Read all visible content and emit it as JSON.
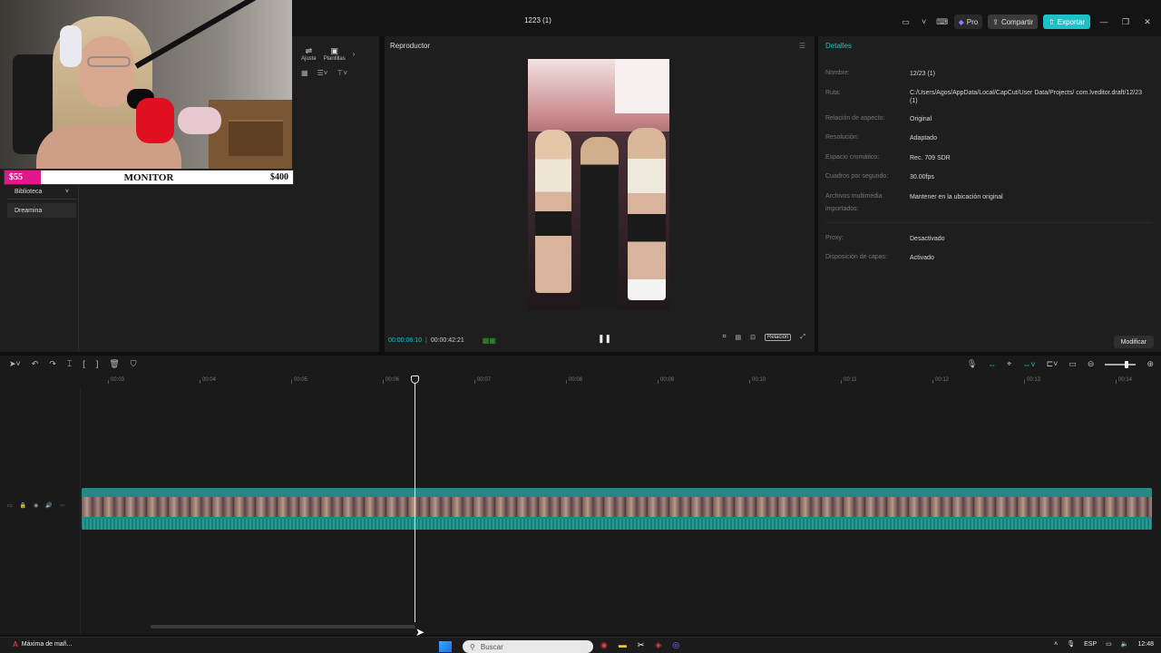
{
  "window": {
    "title": "1223 (1)"
  },
  "titlebar": {
    "pro_label": "Pro",
    "share_label": "Compartir",
    "export_label": "Exportar"
  },
  "overlay": {
    "cost": "$55",
    "label": "MONITOR",
    "goal": "$400"
  },
  "media": {
    "tools": [
      {
        "label": "Ajuste",
        "icon": "sliders-icon"
      },
      {
        "label": "Plantillas",
        "icon": "template-icon"
      }
    ],
    "side_items": [
      {
        "label": "Biblioteca"
      },
      {
        "label": "Dreamina"
      }
    ]
  },
  "player": {
    "title": "Reproductor",
    "current_time": "00:00:06:10",
    "total_time": "00:00:42:21",
    "ratio_label": "Relación"
  },
  "details": {
    "title": "Detalles",
    "rows": [
      {
        "key": "Nombre:",
        "value": "12/23 (1)"
      },
      {
        "key": "Ruta:",
        "value": "C:/Users/Agos/AppData/Local/CapCut/User Data/Projects/ com.lveditor.draft/12/23 (1)"
      },
      {
        "key": "Relación de aspecto:",
        "value": "Original"
      },
      {
        "key": "Resolución:",
        "value": "Adaptado"
      },
      {
        "key": "Espacio cromático:",
        "value": "Rec. 709 SDR"
      },
      {
        "key": "Cuadros por segundo:",
        "value": "30.00fps"
      },
      {
        "key": "Archivos multimedia importados:",
        "value": "Mantener en la ubicación original"
      },
      {
        "key": "Proxy:",
        "value": "Desactivado"
      },
      {
        "key": "Disposición de capas:",
        "value": "Activado"
      }
    ],
    "modify_label": "Modificar"
  },
  "timeline": {
    "ticks": [
      "00:03",
      "00:04",
      "00:05",
      "00:06",
      "00:07",
      "00:08",
      "00:09",
      "00:10",
      "00:11",
      "00:12",
      "00:13",
      "00:14"
    ],
    "zoom_level": 0.7
  },
  "taskbar": {
    "app_label": "Máxima de mañ...",
    "search_placeholder": "Buscar",
    "lang": "ESP",
    "time": "12:48"
  },
  "colors": {
    "accent": "#1fc1c9",
    "background": "#1e1e1e",
    "overlay_cost": "#e0188c"
  }
}
